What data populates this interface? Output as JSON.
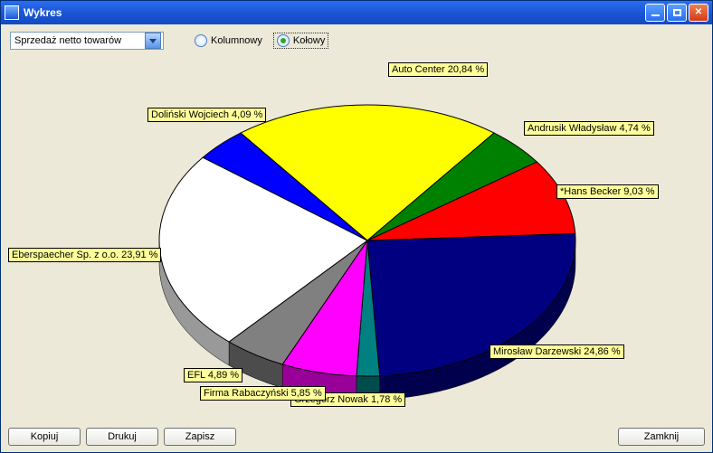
{
  "window": {
    "title": "Wykres"
  },
  "toolbar": {
    "metric": "Sprzedaż netto towarów",
    "radio_column": "Kolumnowy",
    "radio_pie": "Kołowy"
  },
  "buttons": {
    "copy": "Kopiuj",
    "print": "Drukuj",
    "save": "Zapisz",
    "close": "Zamknij"
  },
  "labels": {
    "auto_center": "Auto Center 20,84 %",
    "andrusik": "Andrusik Władysław 4,74 %",
    "hans_becker": "*Hans Becker 9,03 %",
    "darzewski": "Mirosław Darzewski 24,86 %",
    "nowak": "Grzegorz Nowak 1,78 %",
    "rabaczynski": "Firma Rabaczyński 5,85 %",
    "efl": "EFL 4,89 %",
    "eberspaecher": "Eberspaecher Sp. z o.o. 23,91 %",
    "dolinski": "Doliński Wojciech 4,09 %"
  },
  "chart_data": {
    "type": "pie",
    "title": "Wykres",
    "series": [
      {
        "name": "Auto Center",
        "value": 20.84,
        "color": "#ffff00"
      },
      {
        "name": "Andrusik Władysław",
        "value": 4.74,
        "color": "#008000"
      },
      {
        "name": "*Hans Becker",
        "value": 9.03,
        "color": "#ff0000"
      },
      {
        "name": "Mirosław Darzewski",
        "value": 24.86,
        "color": "#000080"
      },
      {
        "name": "Grzegorz Nowak",
        "value": 1.78,
        "color": "#008080"
      },
      {
        "name": "Firma Rabaczyński",
        "value": 5.85,
        "color": "#ff00ff"
      },
      {
        "name": "EFL",
        "value": 4.89,
        "color": "#808080"
      },
      {
        "name": "Eberspaecher Sp. z o.o.",
        "value": 23.91,
        "color": "#ffffff"
      },
      {
        "name": "Doliński Wojciech",
        "value": 4.09,
        "color": "#0000ff"
      }
    ]
  }
}
